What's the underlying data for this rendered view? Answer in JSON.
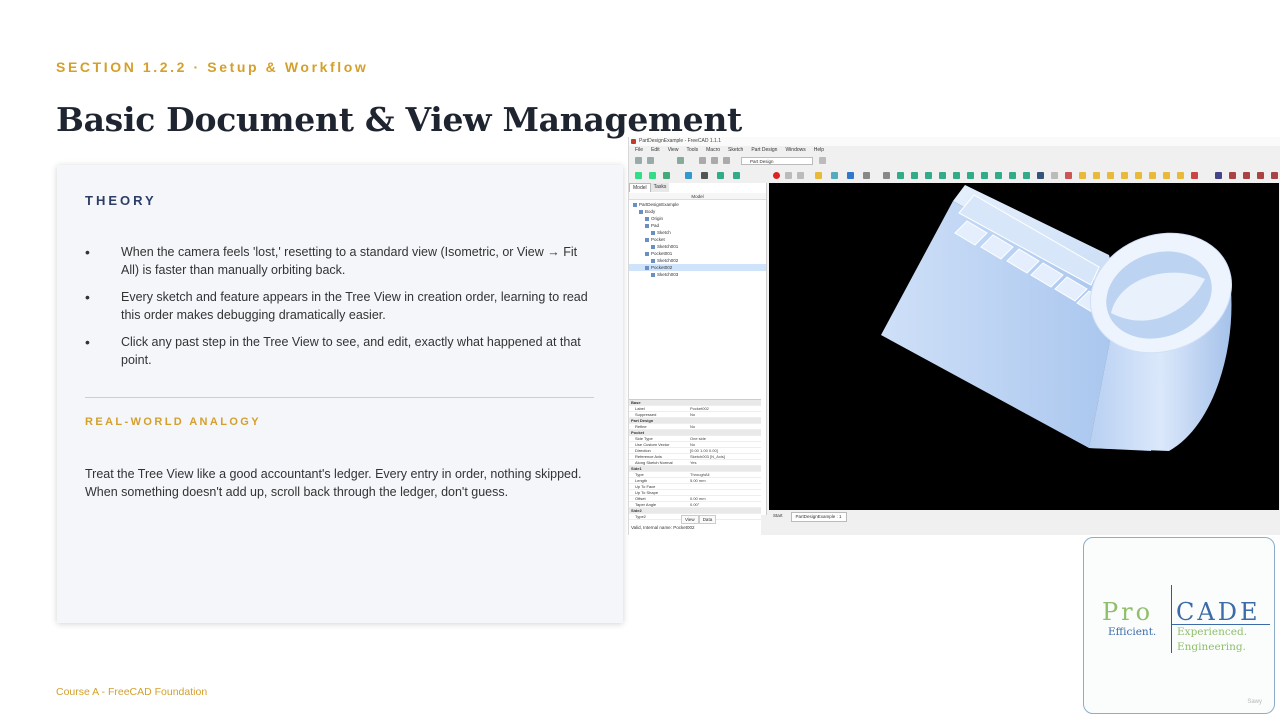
{
  "slide": {
    "section": "SECTION 1.2.2 · Setup & Workflow",
    "title": "Basic Document & View Management",
    "theory_heading": "THEORY",
    "bullets": [
      "When the camera feels 'lost,' resetting to a standard view (Isometric, or View → Fit All) is faster than manually orbiting back.",
      "Every sketch and feature appears in the Tree View in creation order, learning to read this order makes debugging dramatically easier.",
      "Click any past step in the Tree View to see, and edit, exactly what happened at that point."
    ],
    "analogy_heading": "REAL-WORLD ANALOGY",
    "analogy_text": "Treat the Tree View like a good accountant's ledger. Every entry in order, nothing skipped. When something doesn't add up, scroll back through the ledger, don't guess.",
    "footer": "Course A - FreeCAD Foundation"
  },
  "freecad": {
    "window_title": "PartDesignExample - FreeCAD 1.1.1",
    "menu": [
      "File",
      "Edit",
      "View",
      "Tools",
      "Macro",
      "Sketch",
      "Part Design",
      "Windows",
      "Help"
    ],
    "workbench": "Part Design",
    "combo_tabs": [
      "Model",
      "Tasks"
    ],
    "tree_header": "Model",
    "tree": [
      {
        "label": "PartDesignExample",
        "indent": 0
      },
      {
        "label": "Body",
        "indent": 1
      },
      {
        "label": "Origin",
        "indent": 2
      },
      {
        "label": "Pad",
        "indent": 2
      },
      {
        "label": "Sketch",
        "indent": 3
      },
      {
        "label": "Pocket",
        "indent": 2
      },
      {
        "label": "Sketch001",
        "indent": 3
      },
      {
        "label": "Pocket001",
        "indent": 2
      },
      {
        "label": "Sketch002",
        "indent": 3
      },
      {
        "label": "Pocket002",
        "indent": 2,
        "selected": true
      },
      {
        "label": "Sketch003",
        "indent": 3
      }
    ],
    "properties": [
      {
        "group": "Base"
      },
      {
        "key": "Label",
        "value": "Pocket002"
      },
      {
        "key": "Suppressed",
        "value": "No"
      },
      {
        "group": "Part Design"
      },
      {
        "key": "Refine",
        "value": "No"
      },
      {
        "group": "Pocket"
      },
      {
        "key": "Side Type",
        "value": "One side"
      },
      {
        "key": "Use Custom Vector",
        "value": "No"
      },
      {
        "key": "Direction",
        "value": "[0.00 1.00 0.00]"
      },
      {
        "key": "Reference Axis",
        "value": "Sketch003 [N_Axis]"
      },
      {
        "key": "Along Sketch Normal",
        "value": "Yes"
      },
      {
        "group": "Side1"
      },
      {
        "key": "Type",
        "value": "ThroughAll"
      },
      {
        "key": "Length",
        "value": "5.00 mm"
      },
      {
        "key": "Up To Face",
        "value": ""
      },
      {
        "key": "Up To Shape",
        "value": ""
      },
      {
        "key": "Offset",
        "value": "0.00 mm"
      },
      {
        "key": "Taper Angle",
        "value": "0.00°"
      },
      {
        "group": "Side2"
      },
      {
        "key": "Type2",
        "value": "Length"
      }
    ],
    "view_data_tabs": [
      "View",
      "Data"
    ],
    "doc_tabs": [
      "Start",
      "PartDesignExample : 1"
    ],
    "status_text": "Valid, Internal name: Pocket002"
  },
  "logo": {
    "pro": "Pro",
    "cade": "CADE",
    "tagline_left": "Efficient.",
    "tagline_right_1": "Experienced.",
    "tagline_right_2": "Engineering.",
    "badge": "Sawy"
  },
  "colors": {
    "accent_gold": "#d4a02c",
    "heading_navy": "#2c3e66",
    "logo_blue": "#3b6ba8",
    "logo_green": "#8fbf6a"
  }
}
